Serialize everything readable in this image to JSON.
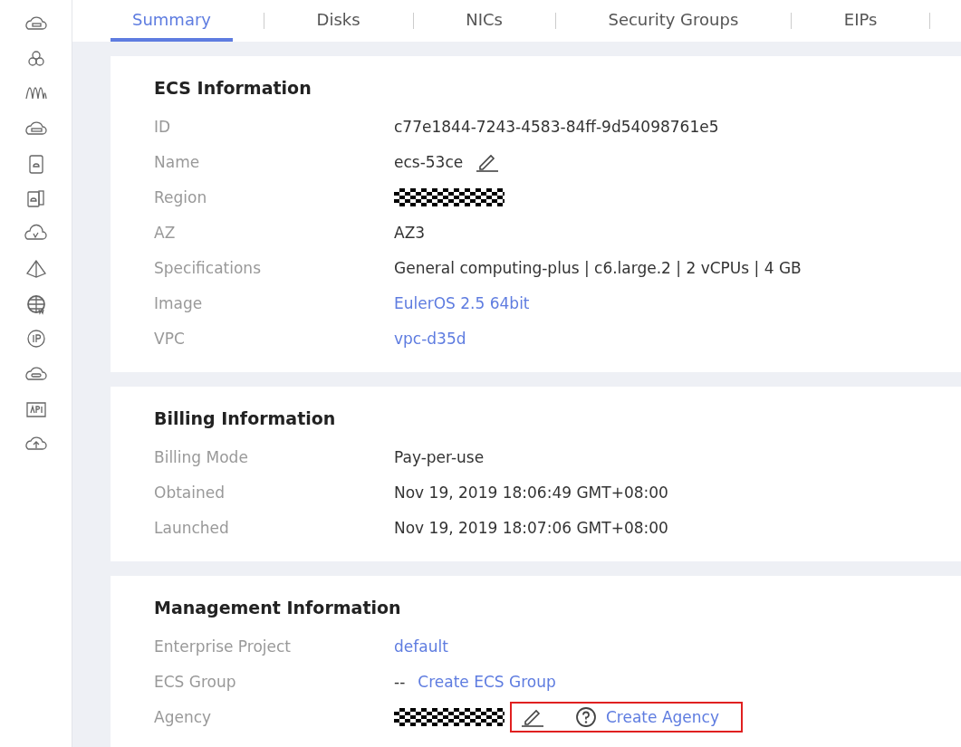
{
  "tabs": [
    {
      "label": "Summary",
      "selected": true
    },
    {
      "label": "Disks",
      "selected": false
    },
    {
      "label": "NICs",
      "selected": false
    },
    {
      "label": "Security Groups",
      "selected": false
    },
    {
      "label": "EIPs",
      "selected": false
    }
  ],
  "sections": [
    {
      "title": "ECS Information",
      "rows": [
        {
          "label": "ID",
          "parts": [
            {
              "kind": "text",
              "text": "c77e1844-7243-4583-84ff-9d54098761e5"
            }
          ]
        },
        {
          "label": "Name",
          "parts": [
            {
              "kind": "text",
              "text": "ecs-53ce"
            },
            {
              "kind": "edit"
            }
          ]
        },
        {
          "label": "Region",
          "parts": [
            {
              "kind": "redacted"
            }
          ]
        },
        {
          "label": "AZ",
          "parts": [
            {
              "kind": "text",
              "text": "AZ3"
            }
          ]
        },
        {
          "label": "Specifications",
          "parts": [
            {
              "kind": "text",
              "text": "General computing-plus | c6.large.2 | 2 vCPUs | 4 GB"
            }
          ]
        },
        {
          "label": "Image",
          "parts": [
            {
              "kind": "link",
              "text": "EulerOS 2.5 64bit"
            }
          ]
        },
        {
          "label": "VPC",
          "parts": [
            {
              "kind": "link",
              "text": "vpc-d35d"
            }
          ]
        }
      ]
    },
    {
      "title": "Billing Information",
      "rows": [
        {
          "label": "Billing Mode",
          "parts": [
            {
              "kind": "text",
              "text": "Pay-per-use"
            }
          ]
        },
        {
          "label": "Obtained",
          "parts": [
            {
              "kind": "text",
              "text": "Nov 19, 2019 18:06:49 GMT+08:00"
            }
          ]
        },
        {
          "label": "Launched",
          "parts": [
            {
              "kind": "text",
              "text": "Nov 19, 2019 18:07:06 GMT+08:00"
            }
          ]
        }
      ]
    },
    {
      "title": "Management Information",
      "rows": [
        {
          "label": "Enterprise Project",
          "parts": [
            {
              "kind": "link",
              "text": "default"
            }
          ]
        },
        {
          "label": "ECS Group",
          "parts": [
            {
              "kind": "text",
              "text": "--"
            },
            {
              "kind": "link",
              "text": "Create ECS Group"
            }
          ]
        },
        {
          "label": "Agency",
          "parts": [
            {
              "kind": "redacted"
            }
          ],
          "callout": [
            {
              "kind": "edit"
            },
            {
              "kind": "help-link",
              "text": "Create Agency"
            }
          ]
        }
      ]
    }
  ]
}
